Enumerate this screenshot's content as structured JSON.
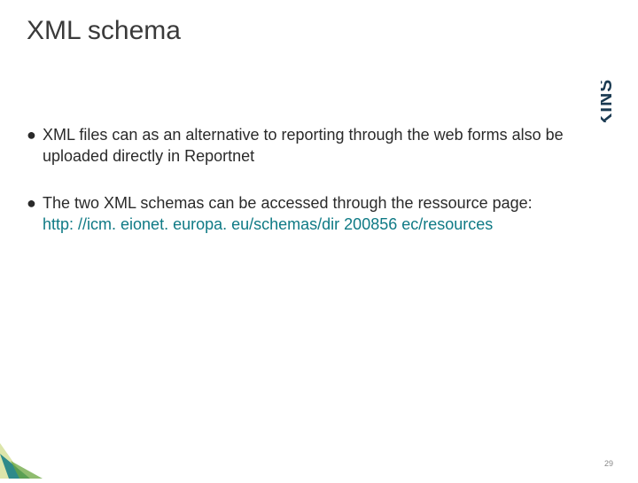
{
  "title": "XML schema",
  "bullets": [
    {
      "text": "XML files can as an alternative to reporting through the web forms also be uploaded directly in Reportnet"
    },
    {
      "text": "The two XML schemas can be accessed through the ressource page:",
      "link": "http: //icm. eionet. europa. eu/schemas/dir 200856 ec/resources"
    }
  ],
  "page_number": "29",
  "brand": "ATKINS",
  "colors": {
    "link": "#0f7a85",
    "logo": "#1a3a52"
  }
}
